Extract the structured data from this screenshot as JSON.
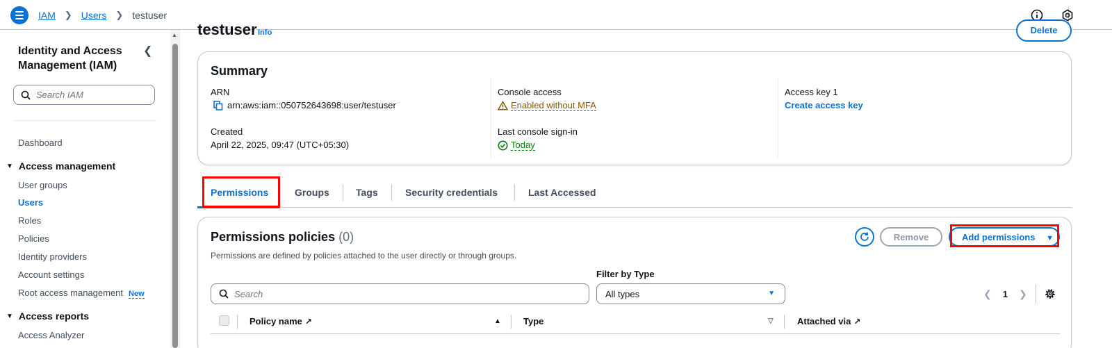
{
  "breadcrumb": {
    "items": [
      "IAM",
      "Users"
    ],
    "current": "testuser"
  },
  "sidebar": {
    "title": "Identity and Access Management (IAM)",
    "search_placeholder": "Search IAM",
    "dashboard": "Dashboard",
    "sections": [
      {
        "label": "Access management",
        "items": [
          "User groups",
          "Users",
          "Roles",
          "Policies",
          "Identity providers",
          "Account settings",
          "Root access management"
        ]
      },
      {
        "label": "Access reports",
        "items": [
          "Access Analyzer"
        ]
      }
    ],
    "new_badge": "New",
    "active_item": "Users"
  },
  "page": {
    "title": "testuser",
    "info": "Info",
    "delete_label": "Delete"
  },
  "summary": {
    "heading": "Summary",
    "arn_label": "ARN",
    "arn_value": "arn:aws:iam::050752643698:user/testuser",
    "created_label": "Created",
    "created_value": "April 22, 2025, 09:47 (UTC+05:30)",
    "console_label": "Console access",
    "console_value": "Enabled without MFA",
    "signin_label": "Last console sign-in",
    "signin_value": "Today",
    "key_label": "Access key 1",
    "key_action": "Create access key"
  },
  "tabs": [
    "Permissions",
    "Groups",
    "Tags",
    "Security credentials",
    "Last Accessed"
  ],
  "permissions": {
    "title": "Permissions policies",
    "count": "(0)",
    "description": "Permissions are defined by policies attached to the user directly or through groups.",
    "remove_label": "Remove",
    "add_label": "Add permissions",
    "filter_label": "Filter by Type",
    "search_placeholder": "Search",
    "type_value": "All types",
    "page": "1",
    "columns": [
      "Policy name",
      "Type",
      "Attached via"
    ]
  },
  "colors": {
    "accent": "#0972d3",
    "highlight": "#ff0000",
    "warning": "#855900",
    "success": "#037f0c"
  }
}
